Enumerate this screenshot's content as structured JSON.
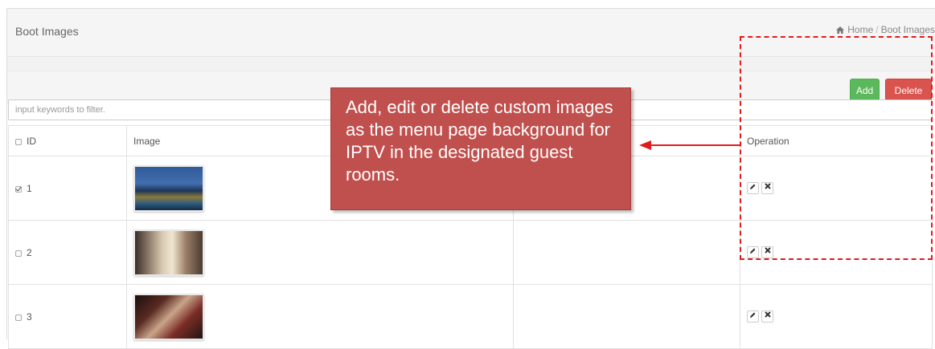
{
  "header": {
    "title": "Boot Images",
    "breadcrumb": {
      "home": "Home",
      "separator": "/",
      "current": "Boot Images"
    }
  },
  "toolbar": {
    "add_label": "Add",
    "delete_label": "Delete"
  },
  "filter": {
    "placeholder": "input keywords to filter."
  },
  "table": {
    "columns": {
      "id": "ID",
      "image": "Image",
      "col3": "",
      "operation": "Operation"
    },
    "rows": [
      {
        "id": "1",
        "checked": true,
        "image": "resort-night-pool-thumbnail",
        "col3": ""
      },
      {
        "id": "2",
        "checked": false,
        "image": "hotel-room-interior-thumbnail",
        "col3": ""
      },
      {
        "id": "3",
        "checked": false,
        "image": "dining-table-thumbnail",
        "col3": ""
      }
    ],
    "operations": {
      "edit": "edit-icon",
      "delete": "close-icon"
    }
  },
  "annotation": {
    "text": "Add, edit or delete custom images as the menu page background for IPTV in the designated guest rooms."
  },
  "colors": {
    "add_button": "#5cb85c",
    "delete_button": "#d9534f",
    "callout": "#c0504d",
    "highlight": "#e11b1b"
  }
}
